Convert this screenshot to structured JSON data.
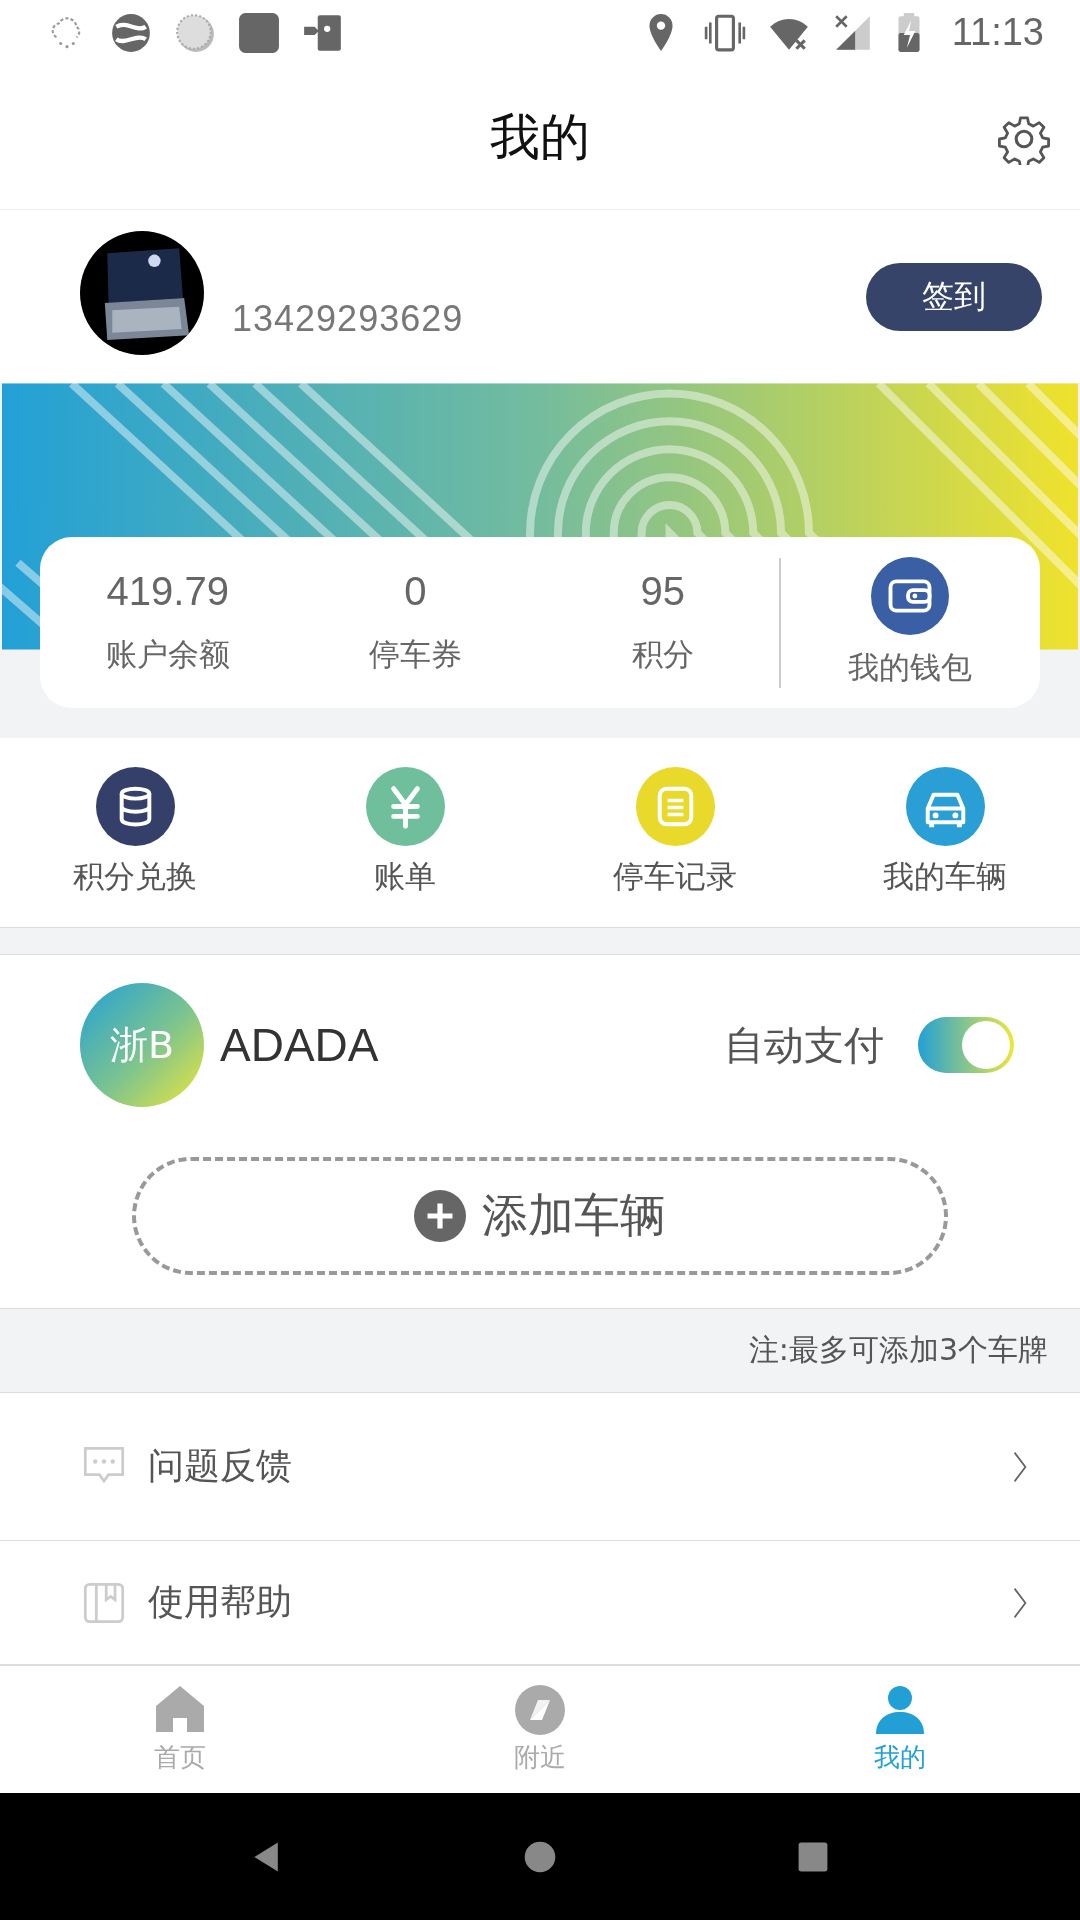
{
  "status_bar": {
    "time": "11:13"
  },
  "header": {
    "title": "我的"
  },
  "profile": {
    "phone": "13429293629",
    "checkin_button": "签到"
  },
  "stats": [
    {
      "value": "419.79",
      "label": "账户余额"
    },
    {
      "value": "0",
      "label": "停车券"
    },
    {
      "value": "95",
      "label": "积分"
    }
  ],
  "wallet": {
    "label": "我的钱包"
  },
  "shortcuts": [
    {
      "label": "积分兑换",
      "kind": "stack",
      "color": "#34406a"
    },
    {
      "label": "账单",
      "kind": "yen",
      "color": "#6fbf9c"
    },
    {
      "label": "停车记录",
      "kind": "list",
      "color": "#e8d92a"
    },
    {
      "label": "我的车辆",
      "kind": "car",
      "color": "#2a9fd6"
    }
  ],
  "vehicle": {
    "plate_prefix": "浙B",
    "plate": "ADADA",
    "auto_pay_label": "自动支付",
    "auto_pay_on": true
  },
  "add_vehicle_button": "添加车辆",
  "note": "注:最多可添加3个车牌",
  "menu": [
    {
      "label": "问题反馈",
      "kind": "chat"
    },
    {
      "label": "使用帮助",
      "kind": "book"
    }
  ],
  "tabs": [
    {
      "label": "首页",
      "kind": "home",
      "selected": false
    },
    {
      "label": "附近",
      "kind": "compass",
      "selected": false
    },
    {
      "label": "我的",
      "kind": "person",
      "selected": true
    }
  ]
}
